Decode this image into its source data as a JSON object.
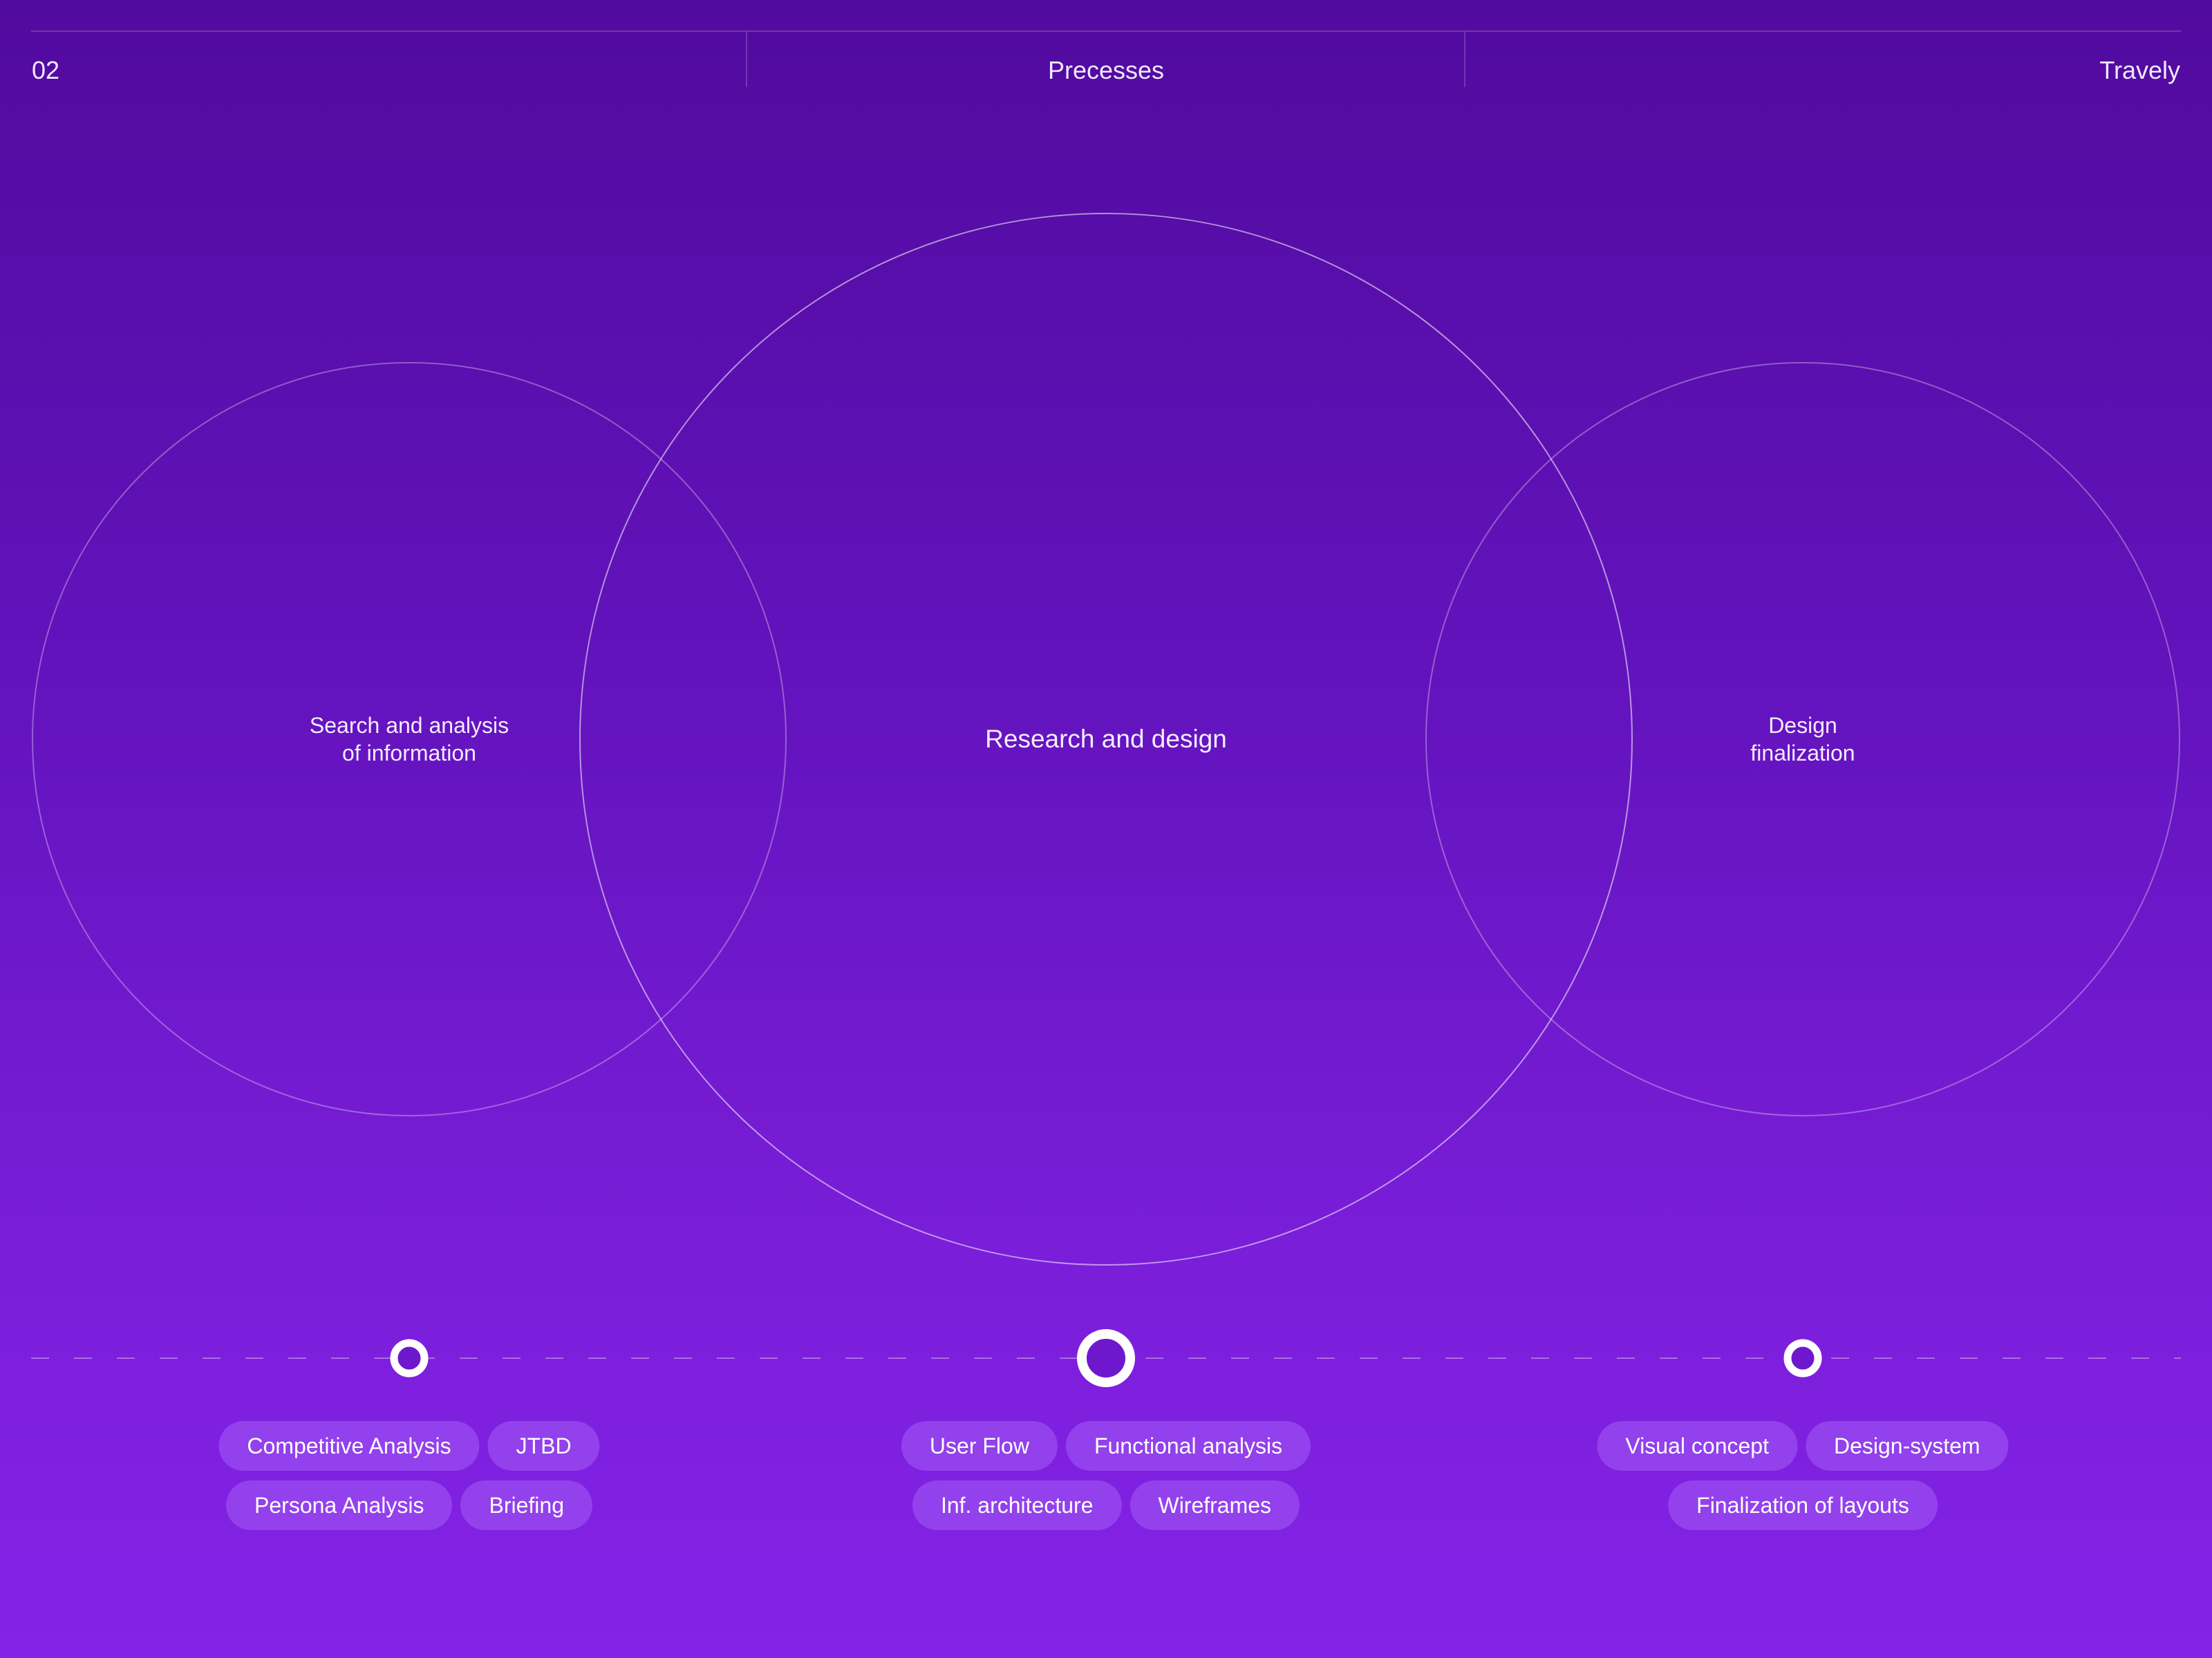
{
  "header": {
    "number": "02",
    "title": "Precesses",
    "brand": "Travely"
  },
  "diagram": {
    "circles": [
      {
        "label": "Search and analysis\nof information",
        "size": "small"
      },
      {
        "label": "Research and design",
        "size": "big"
      },
      {
        "label": "Design\nfinalization",
        "size": "small"
      }
    ]
  },
  "timeline": {
    "stages": [
      {
        "marker": "small",
        "tags": [
          [
            "Competitive Analysis",
            "JTBD"
          ],
          [
            "Persona Analysis",
            "Briefing"
          ]
        ]
      },
      {
        "marker": "big",
        "tags": [
          [
            "User Flow",
            "Functional analysis"
          ],
          [
            "Inf. architecture",
            "Wireframes"
          ]
        ]
      },
      {
        "marker": "small",
        "tags": [
          [
            "Visual concept",
            "Design-system"
          ],
          [
            "Finalization of layouts"
          ]
        ]
      }
    ]
  },
  "colors": {
    "background_top": "#510a9e",
    "background_bottom": "#8422e6",
    "tag_fill": "#a25cf5",
    "stroke": "#ffffff"
  }
}
